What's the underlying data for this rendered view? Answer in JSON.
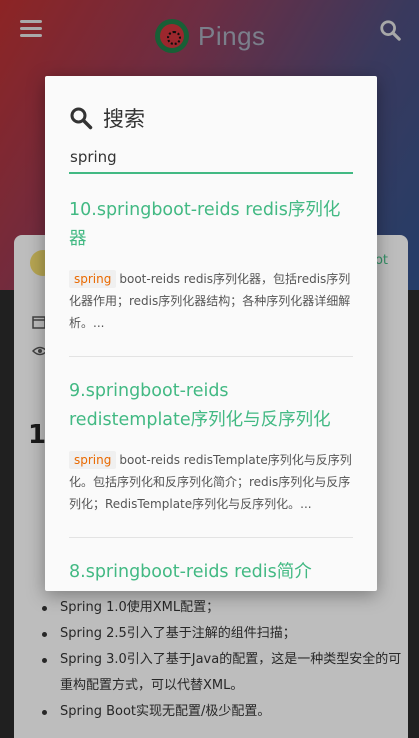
{
  "site": {
    "name": "Pings"
  },
  "icons": {
    "menu": "menu-icon",
    "search": "search-icon",
    "calendar": "calendar-icon",
    "eye": "eye-icon"
  },
  "colors": {
    "accent": "#42b983",
    "keyword": "#e96900",
    "header_start": "#b52f2f",
    "header_end": "#2f4f86"
  },
  "article": {
    "tag_fragment": "ot",
    "heading_fragment": "1",
    "bullets": [
      "Spring 1.0使用XML配置；",
      "Spring 2.5引入了基于注解的组件扫描；",
      "Spring 3.0引入了基于Java的配置，这是一种类型安全的可重构配置方式，可以代替XML。",
      "Spring Boot实现无配置/极少配置。"
    ]
  },
  "search": {
    "title": "搜索",
    "query": "spring",
    "results": [
      {
        "title": "10.springboot-reids redis序列化器",
        "keyword": "spring",
        "snippet": "boot-reids redis序列化器，包括redis序列化器作用；redis序列化器结构；各种序列化器详细解析。..."
      },
      {
        "title": "9.springboot-reids redistemplate序列化与反序列化",
        "keyword": "spring",
        "snippet": "boot-reids redisTemplate序列化与反序列化。包括序列化和反序列化简介；redis序列化与反序列化；RedisTemplate序列化与反序列化。..."
      },
      {
        "title": "8.springboot-reids redis简介"
      }
    ]
  }
}
